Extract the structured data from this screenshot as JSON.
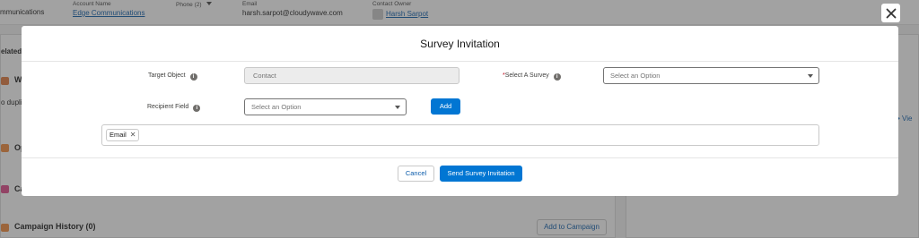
{
  "record_header": {
    "name_fragment": "mmunications",
    "account_name_label": "Account Name",
    "account_name": "Edge Communications",
    "phone_label": "Phone (2)",
    "email_label": "Email",
    "email": "harsh.sarpot@cloudywave.com",
    "owner_label": "Contact Owner",
    "owner": "Harsh Sarpot"
  },
  "background": {
    "related_tab_fragment": "elated",
    "tile_w": "W",
    "tile_w_sub": "o dupli",
    "tile_op": "Op",
    "tile_ca": "Ca",
    "campaign_history": "Campaign History (0)",
    "add_to_campaign": "Add to Campaign",
    "right_fragment_types": "ypes",
    "right_fragment_view": "• Vie"
  },
  "modal": {
    "title": "Survey Invitation",
    "target_object_label": "Target Object",
    "target_object_value": "Contact",
    "select_survey_label": "Select A Survey",
    "select_survey_required": "*",
    "select_survey_placeholder": "Select an Option",
    "recipient_field_label": "Recipient Field",
    "recipient_field_placeholder": "Select an Option",
    "add_label": "Add",
    "pills": [
      "Email"
    ],
    "cancel_label": "Cancel",
    "send_label": "Send Survey Invitation"
  },
  "icons": {
    "close": "close-icon",
    "info": "info-icon",
    "dropdown": "chevron-down-icon",
    "pill_remove": "close-icon"
  },
  "colors": {
    "brand": "#0176d3",
    "link": "#0b5cab",
    "required": "#ba0517"
  }
}
